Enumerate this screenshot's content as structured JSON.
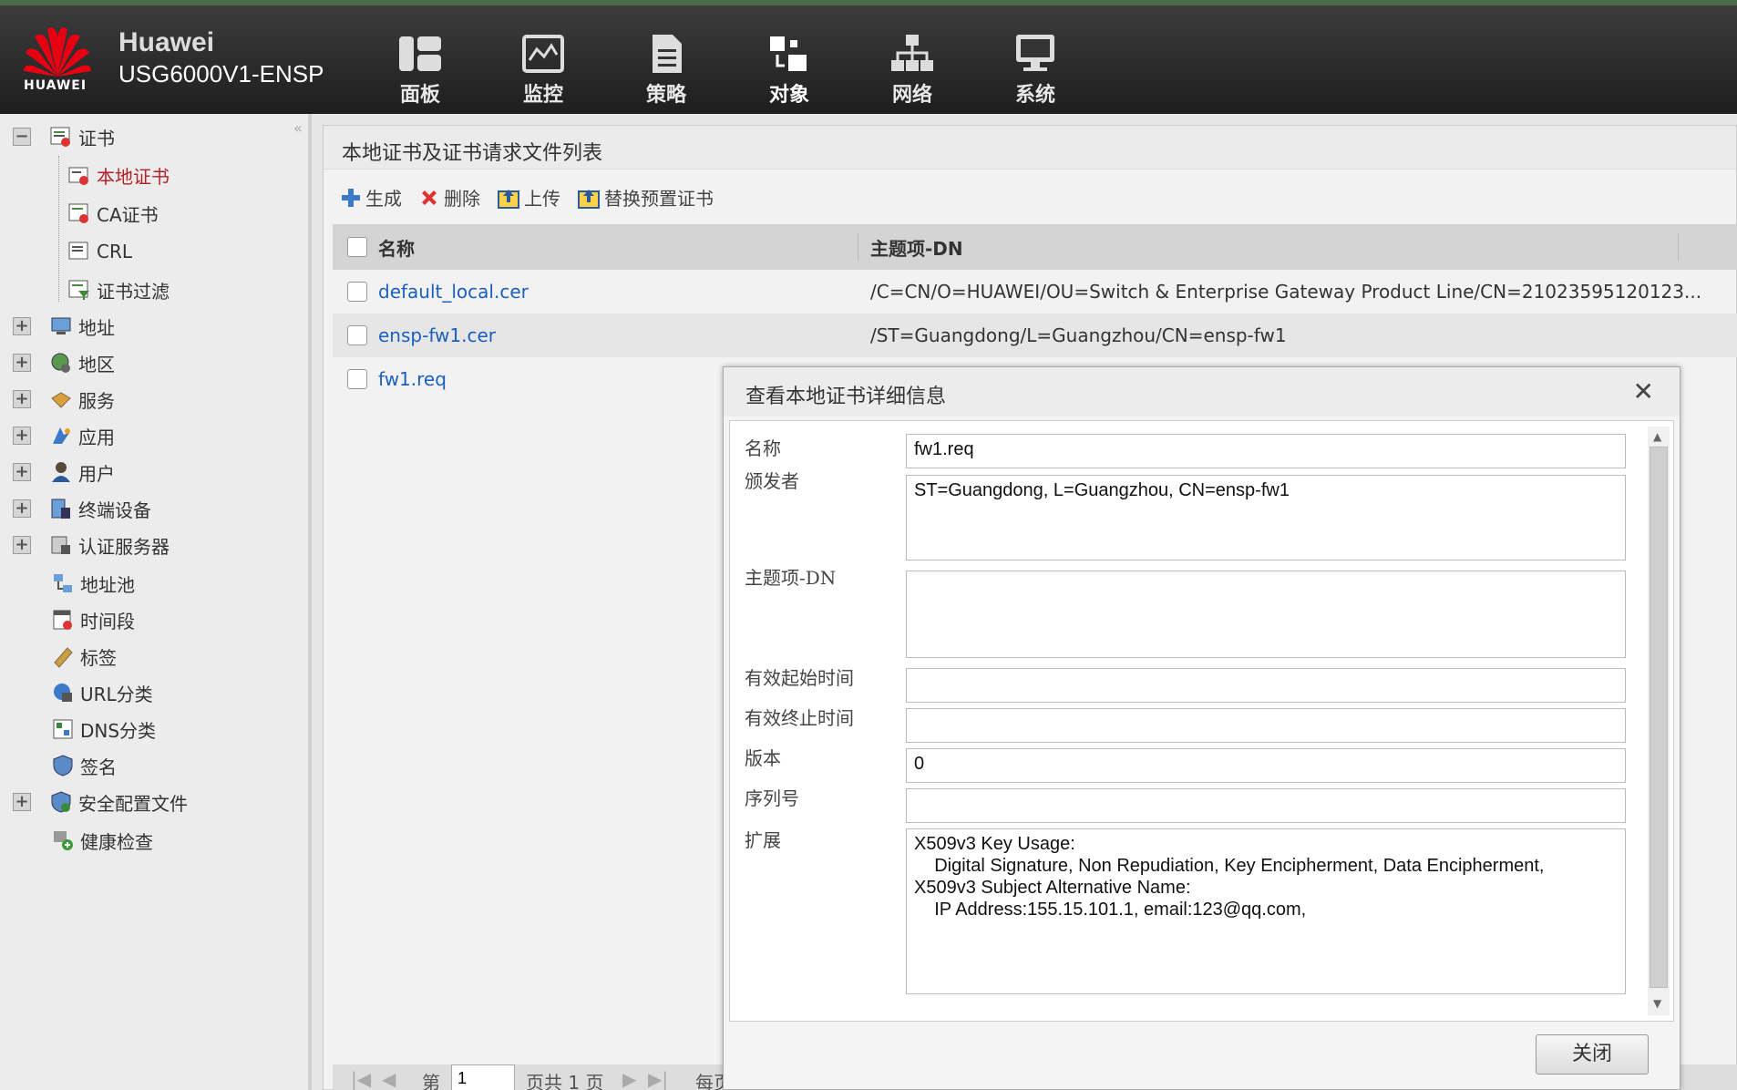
{
  "header": {
    "logo_text": "HUAWEI",
    "brand_name": "Huawei",
    "brand_model": "USG6000V1-ENSP",
    "nav": [
      {
        "label": "面板",
        "icon": "dashboard-icon"
      },
      {
        "label": "监控",
        "icon": "monitor-icon"
      },
      {
        "label": "策略",
        "icon": "policy-icon"
      },
      {
        "label": "对象",
        "icon": "object-icon"
      },
      {
        "label": "网络",
        "icon": "network-icon"
      },
      {
        "label": "系统",
        "icon": "system-icon"
      }
    ],
    "active_nav": "对象"
  },
  "sidebar": {
    "items": [
      {
        "label": "证书",
        "expanded": true
      },
      {
        "label": "本地证书",
        "active": true
      },
      {
        "label": "CA证书"
      },
      {
        "label": "CRL"
      },
      {
        "label": "证书过滤"
      },
      {
        "label": "地址"
      },
      {
        "label": "地区"
      },
      {
        "label": "服务"
      },
      {
        "label": "应用"
      },
      {
        "label": "用户"
      },
      {
        "label": "终端设备"
      },
      {
        "label": "认证服务器"
      },
      {
        "label": "地址池"
      },
      {
        "label": "时间段"
      },
      {
        "label": "标签"
      },
      {
        "label": "URL分类"
      },
      {
        "label": "DNS分类"
      },
      {
        "label": "签名"
      },
      {
        "label": "安全配置文件"
      },
      {
        "label": "健康检查"
      }
    ]
  },
  "main": {
    "title": "本地证书及证书请求文件列表",
    "toolbar": {
      "generate": "生成",
      "delete": "删除",
      "upload": "上传",
      "replace": "替换预置证书"
    },
    "columns": {
      "name": "名称",
      "dn": "主题项-DN"
    },
    "rows": [
      {
        "name": "default_local.cer",
        "dn": "/C=CN/O=HUAWEI/OU=Switch & Enterprise Gateway Product Line/CN=21023595120123..."
      },
      {
        "name": "ensp-fw1.cer",
        "dn": "/ST=Guangdong/L=Guangzhou/CN=ensp-fw1"
      },
      {
        "name": "fw1.req",
        "dn": ""
      }
    ],
    "pager": {
      "page_prefix": "第",
      "page_value": "1",
      "total": "页共 1 页",
      "per_page": "每页"
    }
  },
  "dialog": {
    "title": "查看本地证书详细信息",
    "fields": {
      "name_label": "名称",
      "name_value": "fw1.req",
      "issuer_label": "颁发者",
      "issuer_value": "ST=Guangdong, L=Guangzhou, CN=ensp-fw1",
      "subject_label": "主题项-DN",
      "subject_value": "",
      "start_label": "有效起始时间",
      "start_value": "",
      "end_label": "有效终止时间",
      "end_value": "",
      "version_label": "版本",
      "version_value": "0",
      "serial_label": "序列号",
      "serial_value": "",
      "ext_label": "扩展",
      "ext_value": "X509v3 Key Usage:\n    Digital Signature, Non Repudiation, Key Encipherment, Data Encipherment,\nX509v3 Subject Alternative Name:\n    IP Address:155.15.101.1, email:123@qq.com,"
    },
    "close_label": "关闭"
  },
  "colors": {
    "brand_red": "#e60012",
    "active_text": "#b3202a",
    "link_blue": "#1a5fc0"
  }
}
